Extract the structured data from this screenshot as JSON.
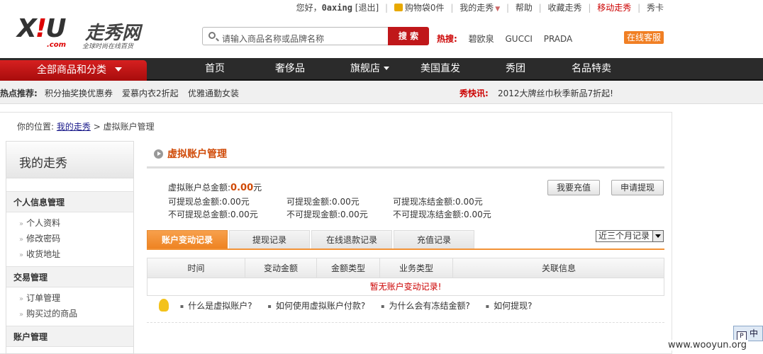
{
  "topbar": {
    "greeting": "您好，",
    "username": "0axing",
    "logout": "[退出]",
    "cart": "购物袋0件",
    "my_xiu": "我的走秀",
    "help": "帮助",
    "favorites": "收藏走秀",
    "mobile": "移动走秀",
    "card": "秀卡"
  },
  "logo": {
    "text_x": "X",
    "text_bang": "!",
    "text_u": "U",
    "text_cn": "走秀网",
    "text_com": ".com",
    "slogan": "全球时尚在线百货"
  },
  "search": {
    "placeholder": "请输入商品名称或品牌名称",
    "button": "搜 索"
  },
  "hot_search": {
    "label": "热搜:",
    "words": [
      "碧欧泉",
      "GUCCI",
      "PRADA"
    ]
  },
  "online_service": "在线客服",
  "nav": {
    "all_categories": "全部商品和分类",
    "items": [
      "首页",
      "奢侈品",
      "旗舰店",
      "美国直发",
      "秀团",
      "名品特卖"
    ]
  },
  "hotbar": {
    "label": "热点推荐:",
    "links": [
      "积分抽奖换优惠券",
      "爱慕内衣2折起",
      "优雅通勤女装"
    ],
    "news_label": "秀快讯:",
    "news": "2012大牌丝巾秋季新品7折起!"
  },
  "breadcrumb": {
    "prefix": "你的位置:",
    "home": "我的走秀",
    "sep": ">",
    "current": "虚拟账户管理"
  },
  "sidebar": {
    "title": "我的走秀",
    "sections": [
      {
        "title": "个人信息管理",
        "links": [
          "个人资料",
          "修改密码",
          "收货地址"
        ]
      },
      {
        "title": "交易管理",
        "links": [
          "订单管理",
          "购买过的商品"
        ]
      },
      {
        "title": "账户管理",
        "links": []
      }
    ]
  },
  "content": {
    "title": "虚拟账户管理",
    "total_label": "虚拟账户总金额:",
    "total_value": "0.00",
    "total_unit": "元",
    "withdrawable_total": "可提现总金额:0.00元",
    "withdrawable": "可提现金额:0.00元",
    "withdrawable_frozen": "可提现冻结金额:0.00元",
    "non_withdrawable_total": "不可提现总金额:0.00元",
    "non_withdrawable": "不可提现金额:0.00元",
    "non_withdrawable_frozen": "不可提现冻结金额:0.00元",
    "recharge_button": "我要充值",
    "withdraw_button": "申请提现"
  },
  "tabs": [
    "账户变动记录",
    "提现记录",
    "在线退款记录",
    "充值记录"
  ],
  "range_select": "近三个月记录",
  "table": {
    "headers": [
      "时间",
      "变动金额",
      "金额类型",
      "业务类型",
      "关联信息"
    ],
    "empty": "暂无账户变动记录!"
  },
  "faq": [
    "什么是虚拟账户?",
    "如何使用虚拟账户付款?",
    "为什么会有冻结金额?",
    "如何提现?"
  ],
  "ime": "中",
  "watermark": "www.wooyun.org"
}
